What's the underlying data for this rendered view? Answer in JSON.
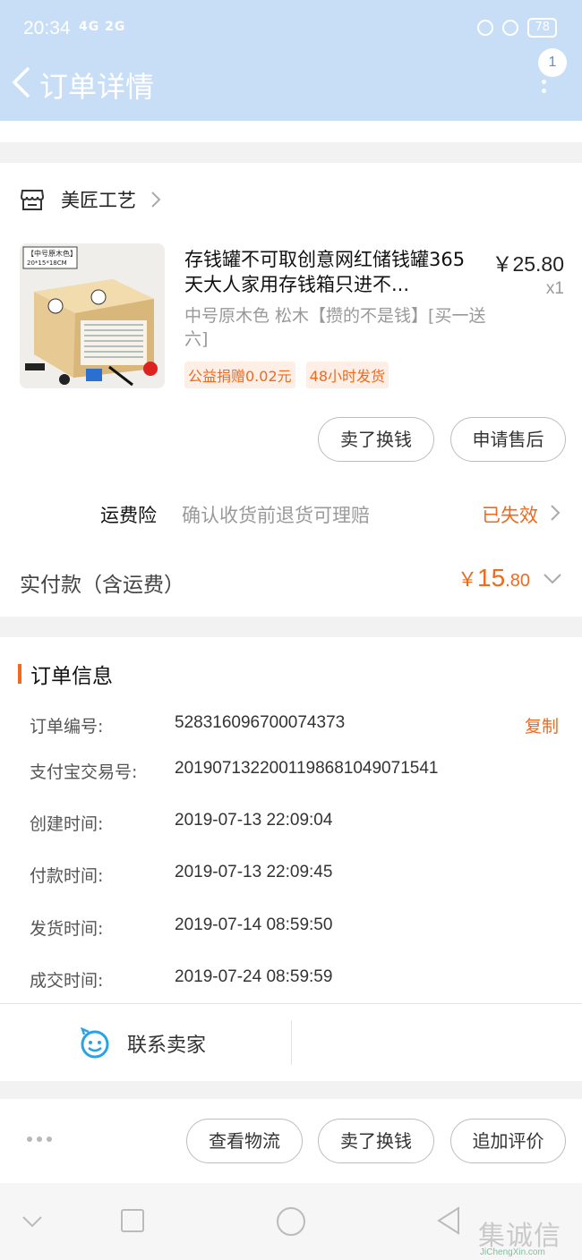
{
  "status_bar": {
    "time": "20:34",
    "signal": "4G 2G",
    "battery": "78"
  },
  "header": {
    "back_icon": "chevron-left-icon",
    "title": "订单详情",
    "badge_count": "1",
    "more_icon": "more-vertical-icon"
  },
  "shop": {
    "icon": "store-icon",
    "name": "美匠工艺"
  },
  "product": {
    "thumb_label": "【中号原木色】",
    "thumb_size": "20*15*18CM",
    "title": "存钱罐不可取创意网红储钱罐365天大人家用存钱箱只进不...",
    "price": "￥25.80",
    "quantity": "x1",
    "sku": "中号原木色 松木【攒的不是钱】[买一送六]",
    "tags": [
      "公益捐赠0.02元",
      "48小时发货"
    ]
  },
  "item_actions": {
    "sell_label": "卖了换钱",
    "after_sale_label": "申请售后"
  },
  "insurance": {
    "label": "运费险",
    "desc": "确认收货前退货可理赔",
    "status": "已失效"
  },
  "payment": {
    "label": "实付款（含运费）",
    "currency": "￥",
    "amount_int": "15",
    "amount_dec": ".80"
  },
  "order_info": {
    "title": "订单信息",
    "copy_label": "复制",
    "rows": [
      {
        "key": "订单编号:",
        "value": "528316096700074373"
      },
      {
        "key": "支付宝交易号:",
        "value": "2019071322001198681049071541"
      },
      {
        "key": "创建时间:",
        "value": "2019-07-13 22:09:04"
      },
      {
        "key": "付款时间:",
        "value": "2019-07-13 22:09:45"
      },
      {
        "key": "发货时间:",
        "value": "2019-07-14 08:59:50"
      },
      {
        "key": "成交时间:",
        "value": "2019-07-24 08:59:59"
      }
    ],
    "contact_label": "联系卖家"
  },
  "bottom_bar": {
    "logistics_label": "查看物流",
    "sell_label": "卖了换钱",
    "review_label": "追加评价"
  },
  "watermark": {
    "cn": "集诚信",
    "en": "JiChengXin.com"
  },
  "colors": {
    "accent": "#ee6a1e",
    "header_bg": "#c8def7",
    "contact_icon": "#2aa3e6"
  }
}
